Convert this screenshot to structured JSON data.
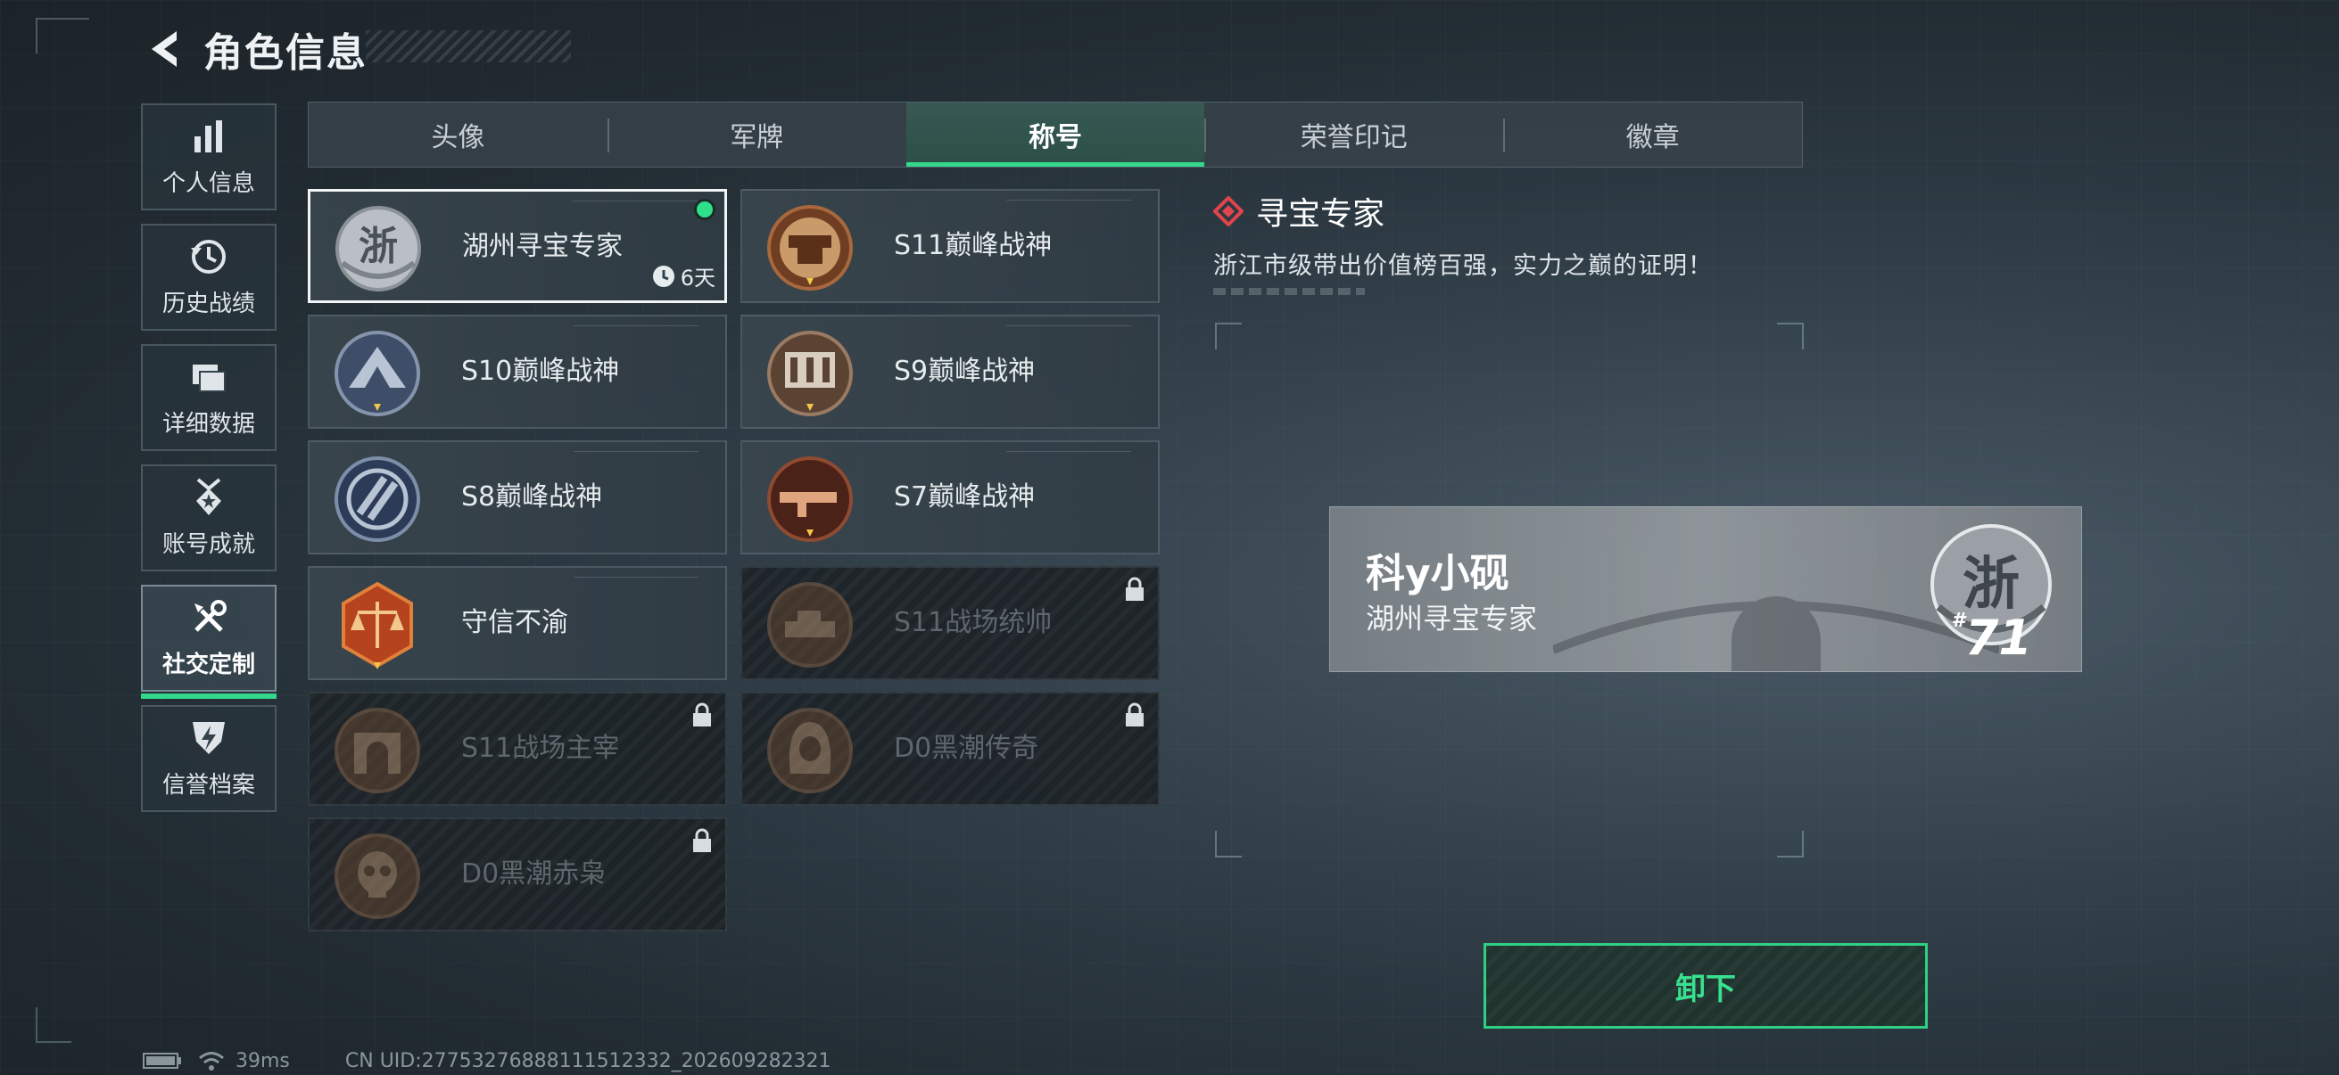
{
  "header": {
    "title": "角色信息"
  },
  "sidebar": {
    "items": [
      {
        "label": "个人信息",
        "icon": "bar-chart-icon",
        "active": false
      },
      {
        "label": "历史战绩",
        "icon": "history-icon",
        "active": false
      },
      {
        "label": "详细数据",
        "icon": "folder-icon",
        "active": false
      },
      {
        "label": "账号成就",
        "icon": "medal-icon",
        "active": false
      },
      {
        "label": "社交定制",
        "icon": "tools-icon",
        "active": true
      },
      {
        "label": "信誉档案",
        "icon": "shield-bolt-icon",
        "active": false
      }
    ]
  },
  "tabs": [
    {
      "label": "头像",
      "active": false
    },
    {
      "label": "军牌",
      "active": false
    },
    {
      "label": "称号",
      "active": true
    },
    {
      "label": "荣誉印记",
      "active": false
    },
    {
      "label": "徽章",
      "active": false
    }
  ],
  "titles": [
    {
      "name": "湖州寻宝专家",
      "emblem": "zhe-emblem",
      "selected": true,
      "equipped": true,
      "timer": "6天",
      "locked": false
    },
    {
      "name": "S11巅峰战神",
      "emblem": "anvil-emblem",
      "locked": false
    },
    {
      "name": "S10巅峰战神",
      "emblem": "bridge-emblem",
      "locked": false
    },
    {
      "name": "S9巅峰战神",
      "emblem": "dam-emblem",
      "locked": false
    },
    {
      "name": "S8巅峰战神",
      "emblem": "stripes-emblem",
      "locked": false
    },
    {
      "name": "S7巅峰战神",
      "emblem": "gun-emblem",
      "locked": false
    },
    {
      "name": "守信不渝",
      "emblem": "scales-emblem",
      "locked": false
    },
    {
      "name": "S11战场统帅",
      "emblem": "tank-emblem",
      "locked": true
    },
    {
      "name": "S11战场主宰",
      "emblem": "arch-emblem",
      "locked": true
    },
    {
      "name": "D0黑潮传奇",
      "emblem": "hood-emblem",
      "locked": true
    },
    {
      "name": "D0黑潮赤枭",
      "emblem": "skull-emblem",
      "locked": true
    }
  ],
  "detail": {
    "title": "寻宝专家",
    "description": "浙江市级带出价值榜百强，实力之巅的证明！"
  },
  "preview": {
    "player_name": "科y小砚",
    "title": "湖州寻宝专家",
    "emblem_char": "浙",
    "rank": "71",
    "rank_prefix": "#"
  },
  "unequip_button": "卸下",
  "status": {
    "ping": "39ms",
    "uid": "CN UID:2775327688811151​2332_202609282321"
  },
  "colors": {
    "accent": "#33d88b",
    "danger": "#e0444c"
  }
}
